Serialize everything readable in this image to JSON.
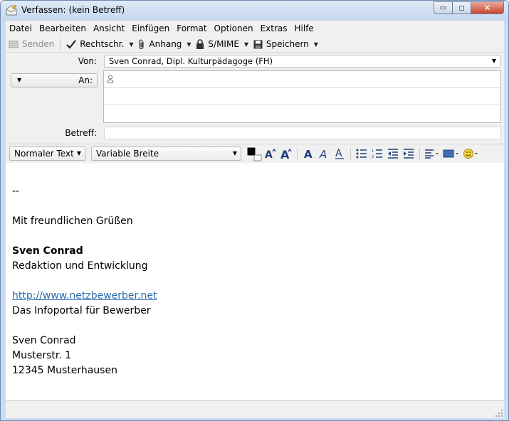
{
  "window": {
    "title": "Verfassen: (kein Betreff)",
    "minimize_glyph": "▭",
    "maximize_glyph": "◻",
    "close_glyph": "✕"
  },
  "menubar": {
    "items": [
      "Datei",
      "Bearbeiten",
      "Ansicht",
      "Einfügen",
      "Format",
      "Optionen",
      "Extras",
      "Hilfe"
    ]
  },
  "toolbar": {
    "send_label": "Senden",
    "spellcheck_label": "Rechtschr.",
    "attach_label": "Anhang",
    "smime_label": "S/MIME",
    "save_label": "Speichern"
  },
  "headers": {
    "from_label": "Von:",
    "from_value": "Sven Conrad, Dipl. Kulturpädagoge (FH)",
    "to_label": "An:",
    "subject_label": "Betreff:",
    "subject_value": ""
  },
  "format": {
    "paragraph_style": "Normaler Text",
    "font_family": "Variable Breite",
    "text_color": "#000000"
  },
  "body": {
    "separator": "--",
    "greeting": "Mit freundlichen Grüßen",
    "name": "Sven Conrad",
    "role": "Redaktion und Entwicklung",
    "link": "http://www.netzbewerber.net",
    "portal": "Das Infoportal für Bewerber",
    "address_name": "Sven Conrad",
    "street": "Musterstr. 1",
    "city": "12345 Musterhausen"
  }
}
